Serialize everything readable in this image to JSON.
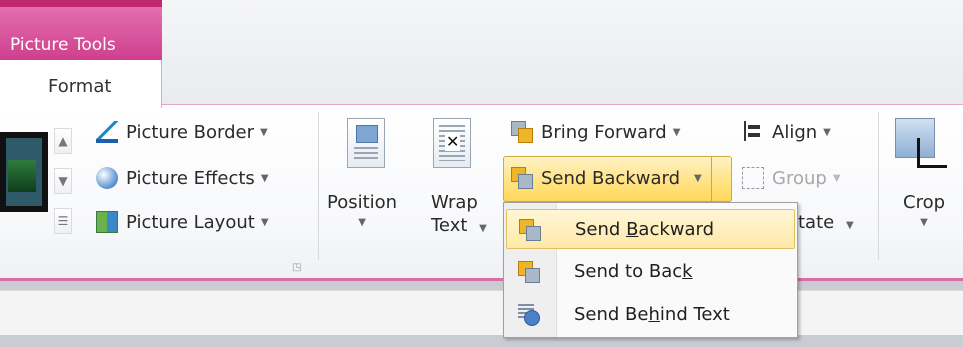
{
  "context_tab": {
    "group_label": "Picture Tools",
    "tab_label": "Format"
  },
  "picture_styles": {
    "border_label": "Picture Border",
    "effects_label": "Picture Effects",
    "layout_label": "Picture Layout"
  },
  "arrange": {
    "position_label": "Position",
    "wrap_label_line1": "Wrap",
    "wrap_label_line2": "Text",
    "bring_forward_label": "Bring Forward",
    "send_backward_label": "Send Backward",
    "align_label": "Align",
    "group_label": "Group",
    "rotate_label_partial": "tate"
  },
  "size": {
    "crop_label": "Crop"
  },
  "dropdown": {
    "items": [
      {
        "label_pre": "Send ",
        "label_u": "B",
        "label_post": "ackward",
        "icon": "send-backward-icon"
      },
      {
        "label_pre": "Send to Bac",
        "label_u": "k",
        "label_post": "",
        "icon": "send-to-back-icon"
      },
      {
        "label_pre": "Send Be",
        "label_u": "h",
        "label_post": "ind Text",
        "icon": "send-behind-text-icon"
      }
    ]
  }
}
